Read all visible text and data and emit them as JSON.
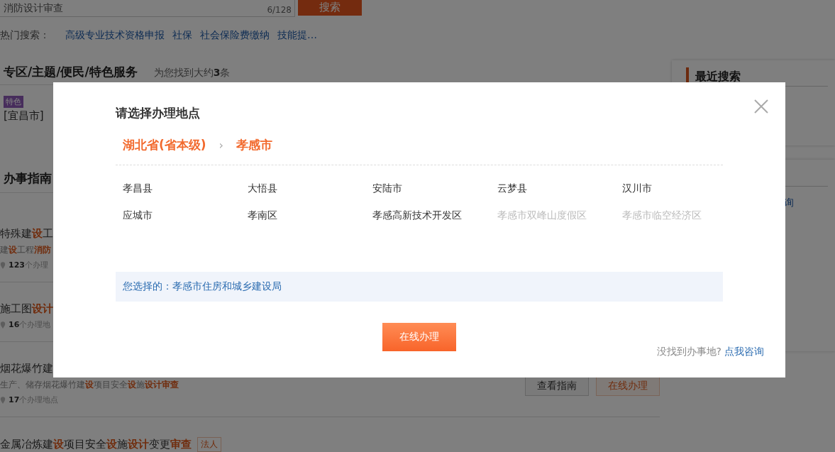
{
  "search": {
    "value": "消防设计审查",
    "counter": "6/128",
    "button": "搜索"
  },
  "hot_searches": {
    "label": "热门搜索：",
    "links": [
      "高级专业技术资格申报",
      "社保",
      "社会保险费缴纳",
      "技能提…"
    ]
  },
  "special_section": {
    "title": "专区/主题/便民/特色服务",
    "result_count": "为您找到大约**3**条",
    "items": [
      {
        "tag": "特色",
        "title": "[宜昌市]"
      }
    ]
  },
  "guide_section": {
    "title": "办事指南",
    "items": [
      {
        "title": "特殊建**设**工",
        "description": "建**设**工程**消防**",
        "locations": "**123**个办理"
      },
      {
        "title": "施工图**设计**",
        "locations": "**16**个办理地"
      },
      {
        "title": "烟花爆竹建",
        "description": "生产、储存烟花爆竹建**设**项目安全**设**施**设计审查**",
        "locations": "**17**个办理地点",
        "buttons": [
          {
            "label": "查看指南",
            "kind": "outline"
          },
          {
            "label": "在线办理",
            "kind": "primary"
          }
        ]
      },
      {
        "title": "金属冶炼建**设**项目安全**设**施**设计**变更**审查**",
        "tag": "法人"
      }
    ]
  },
  "sidebar": {
    "panels": [
      {
        "title": "最近搜索"
      },
      {
        "text": "询"
      }
    ]
  },
  "dialog": {
    "title": "请选择办理地点",
    "breadcrumb": [
      "湖北省(省本级)",
      "孝感市"
    ],
    "separator": "›",
    "locations": [
      {
        "name": "孝昌县",
        "disabled": false
      },
      {
        "name": "大悟县",
        "disabled": false
      },
      {
        "name": "安陆市",
        "disabled": false
      },
      {
        "name": "云梦县",
        "disabled": false
      },
      {
        "name": "汉川市",
        "disabled": false
      },
      {
        "name": "应城市",
        "disabled": false
      },
      {
        "name": "孝南区",
        "disabled": false
      },
      {
        "name": "孝感高新技术开发区",
        "disabled": false
      },
      {
        "name": "孝感市双峰山度假区",
        "disabled": true
      },
      {
        "name": "孝感市临空经济区",
        "disabled": true
      }
    ],
    "selection": {
      "label": "您选择的：",
      "value": "孝感市住房和城乡建设局"
    },
    "submit_button": "在线办理",
    "help": {
      "text": "没找到办事地?",
      "link": "点我咨询"
    }
  }
}
